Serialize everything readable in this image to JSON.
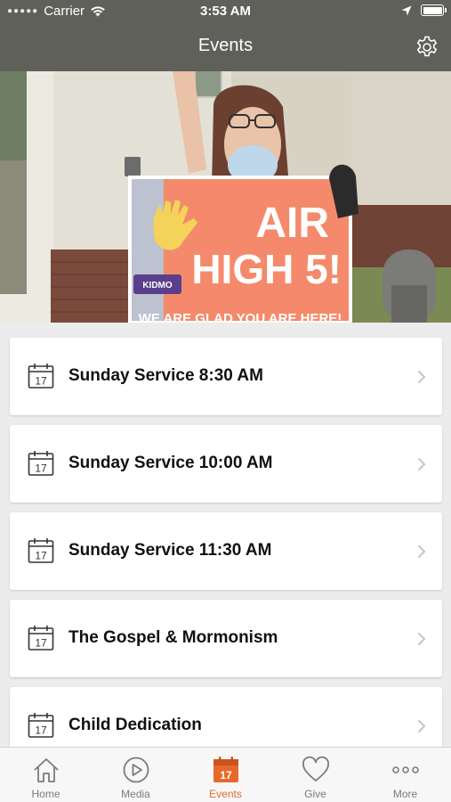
{
  "status": {
    "carrier": "Carrier",
    "time": "3:53 AM"
  },
  "nav": {
    "title": "Events"
  },
  "hero": {
    "sign_line1": "AIR",
    "sign_line2": "HIGH 5!",
    "sign_bottom": "WE ARE GLAD YOU ARE HERE!",
    "sign_logo": "KIDMO"
  },
  "events": [
    {
      "title": "Sunday Service 8:30 AM",
      "icon_day": "17"
    },
    {
      "title": "Sunday Service 10:00 AM",
      "icon_day": "17"
    },
    {
      "title": "Sunday Service 11:30 AM",
      "icon_day": "17"
    },
    {
      "title": "The Gospel & Mormonism",
      "icon_day": "17"
    },
    {
      "title": "Child Dedication",
      "icon_day": "17"
    }
  ],
  "tabs": [
    {
      "label": "Home",
      "icon": "home-icon"
    },
    {
      "label": "Media",
      "icon": "play-icon"
    },
    {
      "label": "Events",
      "icon": "calendar-icon",
      "active": true,
      "day": "17"
    },
    {
      "label": "Give",
      "icon": "heart-icon"
    },
    {
      "label": "More",
      "icon": "more-icon"
    }
  ],
  "colors": {
    "bar": "#5f6059",
    "accent": "#e6692b",
    "background": "#ececec"
  }
}
